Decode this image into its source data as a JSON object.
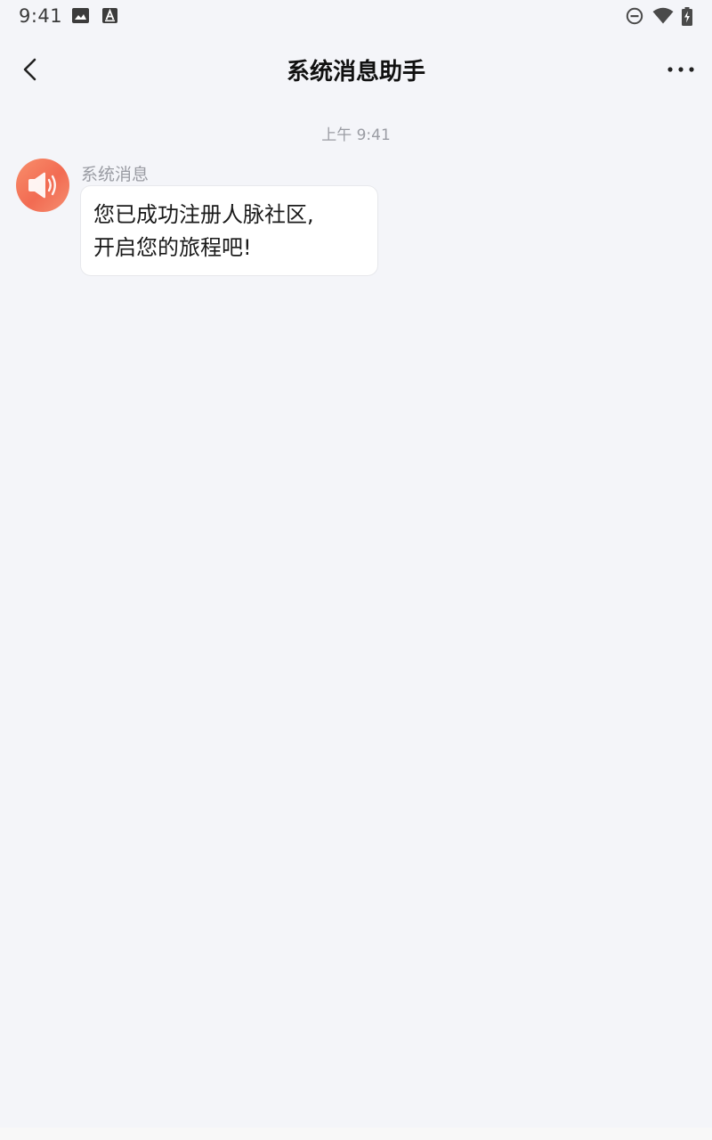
{
  "status_bar": {
    "time": "9:41",
    "left_icons": [
      "image-icon",
      "font-a-icon"
    ],
    "right_icons": [
      "do-not-disturb-icon",
      "wifi-icon",
      "battery-charging-icon"
    ]
  },
  "header": {
    "title": "系统消息助手",
    "back_icon": "chevron-left-icon",
    "more_icon": "more-horizontal-icon"
  },
  "chat": {
    "timestamp": "上午 9:41",
    "messages": [
      {
        "sender": "系统消息",
        "avatar_icon": "speaker-icon",
        "lines": [
          "您已成功注册人脉社区,",
          "开启您的旅程吧!"
        ]
      }
    ]
  },
  "colors": {
    "background": "#f4f5f9",
    "avatar_gradient_start": "#f88f6c",
    "avatar_gradient_end": "#f26b52",
    "bubble": "#ffffff",
    "muted_text": "#9a9ca3"
  }
}
